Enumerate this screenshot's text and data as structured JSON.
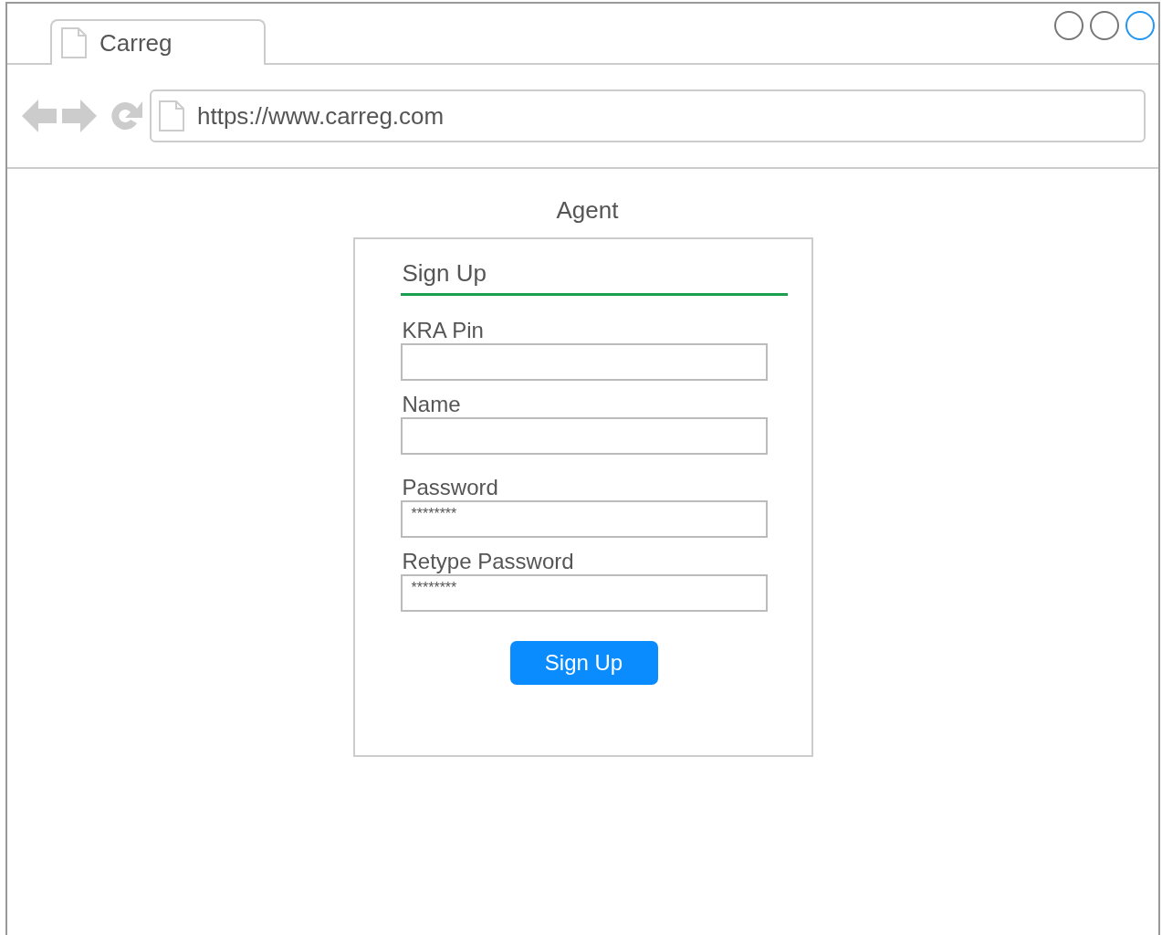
{
  "window": {
    "tab_title": "Carreg",
    "controls": [
      {
        "selected": false
      },
      {
        "selected": false
      },
      {
        "selected": true
      }
    ]
  },
  "address_bar": {
    "url": "https://www.carreg.com"
  },
  "page": {
    "heading": "Agent",
    "form": {
      "title": "Sign Up",
      "fields": [
        {
          "label": "KRA Pin"
        },
        {
          "label": "Name"
        },
        {
          "label": "Password",
          "value": "********"
        },
        {
          "label": "Retype Password",
          "value": "********"
        }
      ],
      "submit": "Sign Up"
    }
  }
}
